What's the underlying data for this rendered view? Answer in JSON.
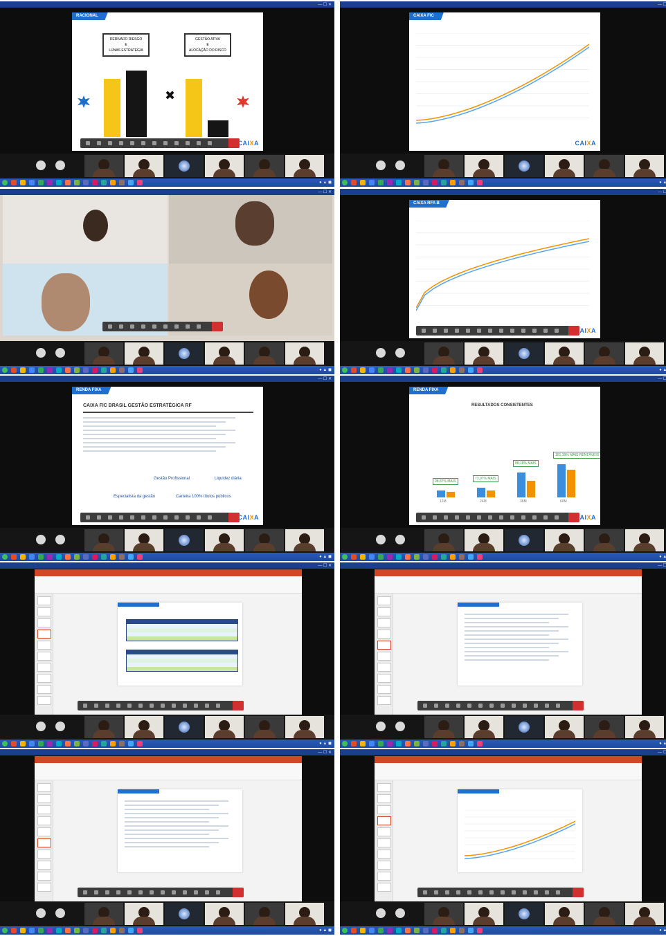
{
  "caixa_logo": {
    "prefix": "CAI",
    "x": "X",
    "suffix": "A"
  },
  "slides": {
    "slide1": {
      "tag": "RACIONAL",
      "box_left": "DERIVADO RIESGO\nE\nLUNAS ESTRATEGIA",
      "box_right": "GESTÃO ATIVA\nE\nALOCAÇÃO DO RISCO",
      "cross": "✖"
    },
    "slide2": {
      "tag": "CAIXA FIC"
    },
    "slide4": {
      "tag": "CAIXA RFA B"
    },
    "slide5": {
      "tag": "RENDA FIXA",
      "title": "CAIXA FIC BRASIL GESTÃO ESTRATÉGICA RF",
      "items": [
        "Gestão Profissional",
        "Liquidez diária",
        "Especialista da gestão",
        "Carteira 100% títulos públicos"
      ]
    },
    "slide6": {
      "tag": "RENDA FIXA",
      "title": "RESULTADOS CONSISTENTES",
      "badges": [
        "98,87% MAIS",
        "73,07% MAIS",
        "88,18% MAIS",
        "151,39% MAIS RENTÁVEIS"
      ],
      "bar_labels": [
        "12M",
        "24M",
        "36M",
        "60M"
      ]
    }
  },
  "colors": {
    "caixa_blue": "#1f6fcf",
    "caixa_orange": "#f39200",
    "windows_bar": "#1d4aa0",
    "ppt_red": "#d24726"
  },
  "icons": [
    "settings-icon",
    "mic-icon",
    "camera-icon",
    "share-icon",
    "hangup-icon"
  ]
}
